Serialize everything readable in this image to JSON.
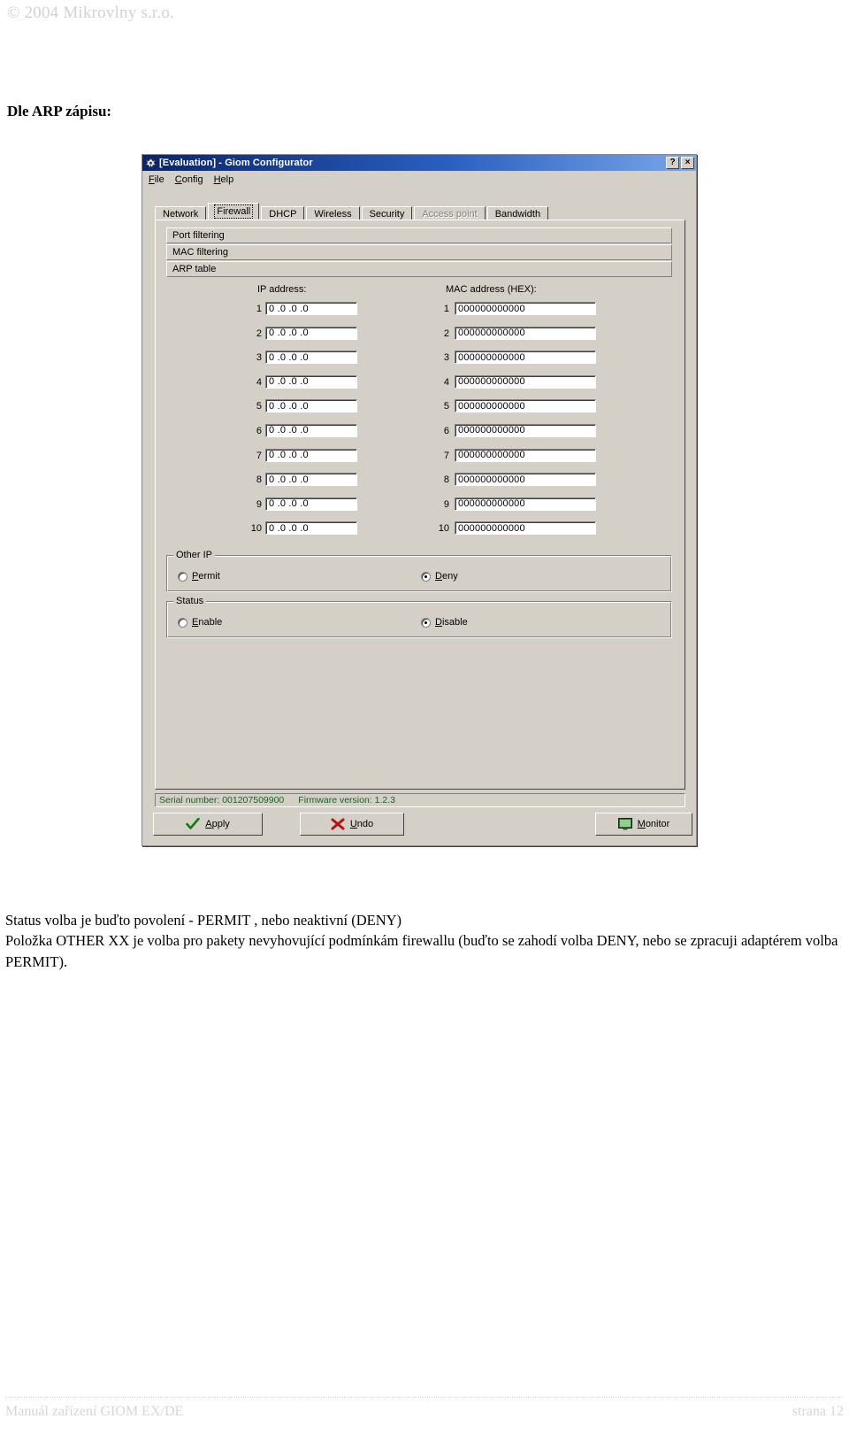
{
  "document": {
    "header_copyright": "© 2004 Mikrovlny s.r.o.",
    "heading": "Dle ARP zápisu:",
    "body_lines": [
      "Status volba je buďto povolení - PERMIT , nebo neaktivní (DENY)",
      "Položka OTHER XX je volba pro pakety nevyhovující podmínkám firewallu (buďto se zahodí volba DENY, nebo se zpracuji adaptérem volba PERMIT)."
    ],
    "footer_left": "Manuál zařízení GIOM EX/DE",
    "footer_right": "strana 12"
  },
  "window": {
    "title": "[Evaluation] - Giom Configurator",
    "icon": "app-icon",
    "help_button": "?",
    "close_button": "×",
    "menu": [
      {
        "label": "File",
        "prefix": "F",
        "rest": "ile"
      },
      {
        "label": "Config",
        "prefix": "C",
        "rest": "onfig"
      },
      {
        "label": "Help",
        "prefix": "H",
        "rest": "elp"
      }
    ],
    "tabs": [
      {
        "label": "Network",
        "selected": false,
        "disabled": false
      },
      {
        "label": "Firewall",
        "selected": true,
        "disabled": false
      },
      {
        "label": "DHCP",
        "selected": false,
        "disabled": false
      },
      {
        "label": "Wireless",
        "selected": false,
        "disabled": false
      },
      {
        "label": "Security",
        "selected": false,
        "disabled": false
      },
      {
        "label": "Access point",
        "selected": false,
        "disabled": true
      },
      {
        "label": "Bandwidth",
        "selected": false,
        "disabled": false
      }
    ],
    "sections": [
      {
        "label": "Port filtering"
      },
      {
        "label": "MAC filtering"
      },
      {
        "label": "ARP table"
      }
    ],
    "arp_table": {
      "ip_column_label": "IP address:",
      "mac_column_label": "MAC address (HEX):",
      "rows": [
        {
          "index": "1",
          "ip": "0 .0 .0 .0",
          "mac": "000000000000"
        },
        {
          "index": "2",
          "ip": "0 .0 .0 .0",
          "mac": "000000000000"
        },
        {
          "index": "3",
          "ip": "0 .0 .0 .0",
          "mac": "000000000000"
        },
        {
          "index": "4",
          "ip": "0 .0 .0 .0",
          "mac": "000000000000"
        },
        {
          "index": "5",
          "ip": "0 .0 .0 .0",
          "mac": "000000000000"
        },
        {
          "index": "6",
          "ip": "0 .0 .0 .0",
          "mac": "000000000000"
        },
        {
          "index": "7",
          "ip": "0 .0 .0 .0",
          "mac": "000000000000"
        },
        {
          "index": "8",
          "ip": "0 .0 .0 .0",
          "mac": "000000000000"
        },
        {
          "index": "9",
          "ip": "0 .0 .0 .0",
          "mac": "000000000000"
        },
        {
          "index": "10",
          "ip": "0 .0 .0 .0",
          "mac": "000000000000"
        }
      ]
    },
    "other_ip_group": {
      "title": "Other IP",
      "options": [
        {
          "label": "Permit",
          "accel": "P",
          "rest": "ermit",
          "selected": false
        },
        {
          "label": "Deny",
          "accel": "D",
          "rest": "eny",
          "selected": true
        }
      ]
    },
    "status_group": {
      "title": "Status",
      "options": [
        {
          "label": "Enable",
          "accel": "E",
          "rest": "nable",
          "selected": false
        },
        {
          "label": "Disable",
          "accel": "D",
          "rest": "isable",
          "selected": true
        }
      ]
    },
    "statusbar": {
      "serial_label": "Serial number: 001207509900",
      "firmware_label": "Firmware version:  1.2.3"
    },
    "buttons": [
      {
        "label": "Apply",
        "accel": "A",
        "rest": "pply",
        "icon": "green-check-icon"
      },
      {
        "label": "Undo",
        "accel": "U",
        "rest": "ndo",
        "icon": "red-x-icon"
      },
      {
        "label": "Monitor",
        "accel": "M",
        "rest": "onitor",
        "icon": "monitor-icon"
      }
    ]
  },
  "colors": {
    "window_face": "#d4d0c8",
    "title_start": "#0a246a",
    "title_end": "#7aa6e8",
    "status_text": "#1d5f21",
    "doc_gray": "#d2d2d2"
  }
}
